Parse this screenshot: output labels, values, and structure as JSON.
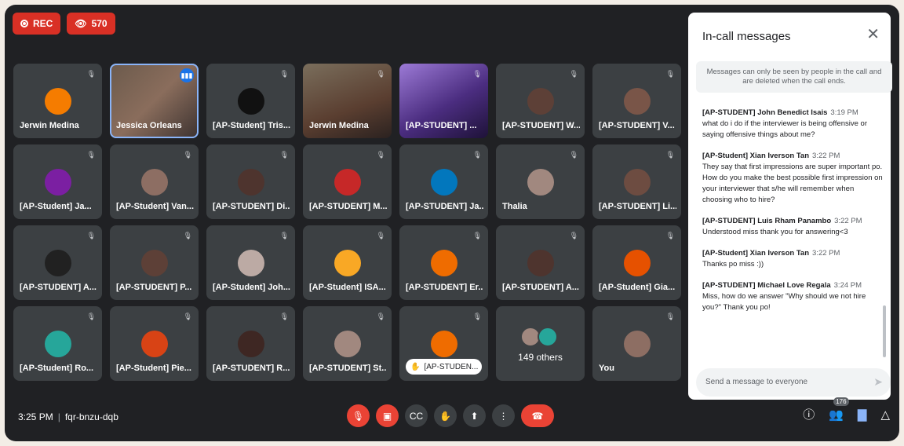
{
  "recording": {
    "label": "REC",
    "viewers": "570"
  },
  "tiles": [
    {
      "name": "Jerwin Medina",
      "type": "avatar",
      "color": "#f57c00"
    },
    {
      "name": "Jessica Orleans",
      "type": "video",
      "speaking": true
    },
    {
      "name": "[AP-Student] Tris...",
      "type": "avatar",
      "color": "#111111"
    },
    {
      "name": "Jerwin Medina",
      "type": "video2"
    },
    {
      "name": "[AP-STUDENT] ...",
      "type": "video3"
    },
    {
      "name": "[AP-STUDENT] W...",
      "type": "avatar",
      "color": "#5d4037"
    },
    {
      "name": "[AP-STUDENT] V...",
      "type": "avatar",
      "color": "#795548"
    },
    {
      "name": "[AP-Student] Ja...",
      "type": "avatar",
      "color": "#7b1fa2"
    },
    {
      "name": "[AP-Student] Van...",
      "type": "avatar",
      "color": "#8d6e63"
    },
    {
      "name": "[AP-STUDENT] Di...",
      "type": "avatar",
      "color": "#4e342e"
    },
    {
      "name": "[AP-STUDENT] M...",
      "type": "avatar",
      "color": "#c62828"
    },
    {
      "name": "[AP-STUDENT] Ja...",
      "type": "avatar",
      "color": "#0277bd"
    },
    {
      "name": "Thalia",
      "type": "avatar",
      "color": "#a1887f"
    },
    {
      "name": "[AP-STUDENT] Li...",
      "type": "avatar",
      "color": "#6d4c41"
    },
    {
      "name": "[AP-STUDENT] A...",
      "type": "avatar",
      "color": "#212121"
    },
    {
      "name": "[AP-STUDENT] P...",
      "type": "avatar",
      "color": "#5d4037"
    },
    {
      "name": "[AP-Student] Joh...",
      "type": "avatar",
      "color": "#bcaaa4"
    },
    {
      "name": "[AP-Student] ISA...",
      "type": "avatar",
      "color": "#f9a825"
    },
    {
      "name": "[AP-STUDENT] Er...",
      "type": "avatar",
      "color": "#ef6c00"
    },
    {
      "name": "[AP-STUDENT] A...",
      "type": "avatar",
      "color": "#4e342e"
    },
    {
      "name": "[AP-Student] Gia...",
      "type": "avatar",
      "color": "#e65100"
    },
    {
      "name": "[AP-Student] Ro...",
      "type": "avatar",
      "color": "#26a69a"
    },
    {
      "name": "[AP-Student] Pie...",
      "type": "avatar",
      "color": "#d84315"
    },
    {
      "name": "[AP-STUDENT] R...",
      "type": "avatar",
      "color": "#3e2723"
    },
    {
      "name": "[AP-STUDENT] St...",
      "type": "avatar",
      "color": "#a1887f"
    },
    {
      "name": "[AP-STUDEN...",
      "type": "chip",
      "color": "#ef6c00"
    },
    {
      "name": "149 others",
      "type": "others"
    },
    {
      "name": "You",
      "type": "avatar",
      "color": "#8d6e63"
    }
  ],
  "panel": {
    "title": "In-call messages",
    "notice": "Messages can only be seen by people in the call and are deleted when the call ends.",
    "messages": [
      {
        "author": "[AP-STUDENT] John Benedict Isais",
        "time": "3:19 PM",
        "text": "what do i do if the interviewer is being offensive or saying offensive things about me?"
      },
      {
        "author": "[AP-Student] Xian Iverson Tan",
        "time": "3:22 PM",
        "text": "They say that first impressions are super important po. How do you make the best possible first impression on your interviewer that s/he will remember when choosing who to hire?"
      },
      {
        "author": "[AP-STUDENT] Luis Rham Panambo",
        "time": "3:22 PM",
        "text": "Understood miss thank you for answering<3"
      },
      {
        "author": "[AP-Student] Xian Iverson Tan",
        "time": "3:22 PM",
        "text": "Thanks po miss :))"
      },
      {
        "author": "[AP-STUDENT] Michael Love Regala",
        "time": "3:24 PM",
        "text": "Miss, how do we answer \"Why should we not hire you?\" Thank you po!"
      }
    ],
    "input_placeholder": "Send a message to everyone"
  },
  "bottom": {
    "time": "3:25 PM",
    "meeting_code": "fqr-bnzu-dqb",
    "people_count": "176"
  },
  "colors": {
    "background": "#202124",
    "danger": "#ea4335",
    "tile": "#3c4043",
    "accent": "#8ab4f8"
  }
}
